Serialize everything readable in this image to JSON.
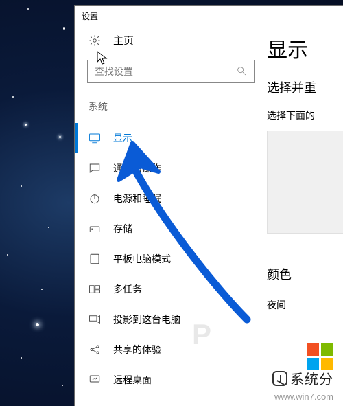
{
  "window": {
    "title": "设置"
  },
  "home": {
    "label": "主页"
  },
  "search": {
    "placeholder": "查找设置"
  },
  "group": {
    "label": "系统"
  },
  "nav": [
    {
      "label": "显示",
      "active": true
    },
    {
      "label": "通知和操作"
    },
    {
      "label": "电源和睡眠"
    },
    {
      "label": "存储"
    },
    {
      "label": "平板电脑模式"
    },
    {
      "label": "多任务"
    },
    {
      "label": "投影到这台电脑"
    },
    {
      "label": "共享的体验"
    },
    {
      "label": "远程桌面"
    }
  ],
  "right": {
    "title": "显示",
    "sub1": "选择并重",
    "sub2": "选择下面的",
    "sub3": "颜色",
    "sub4": "夜间"
  },
  "watermark": {
    "letter": "P",
    "brand": "系统分",
    "url": "www.win7.com"
  }
}
